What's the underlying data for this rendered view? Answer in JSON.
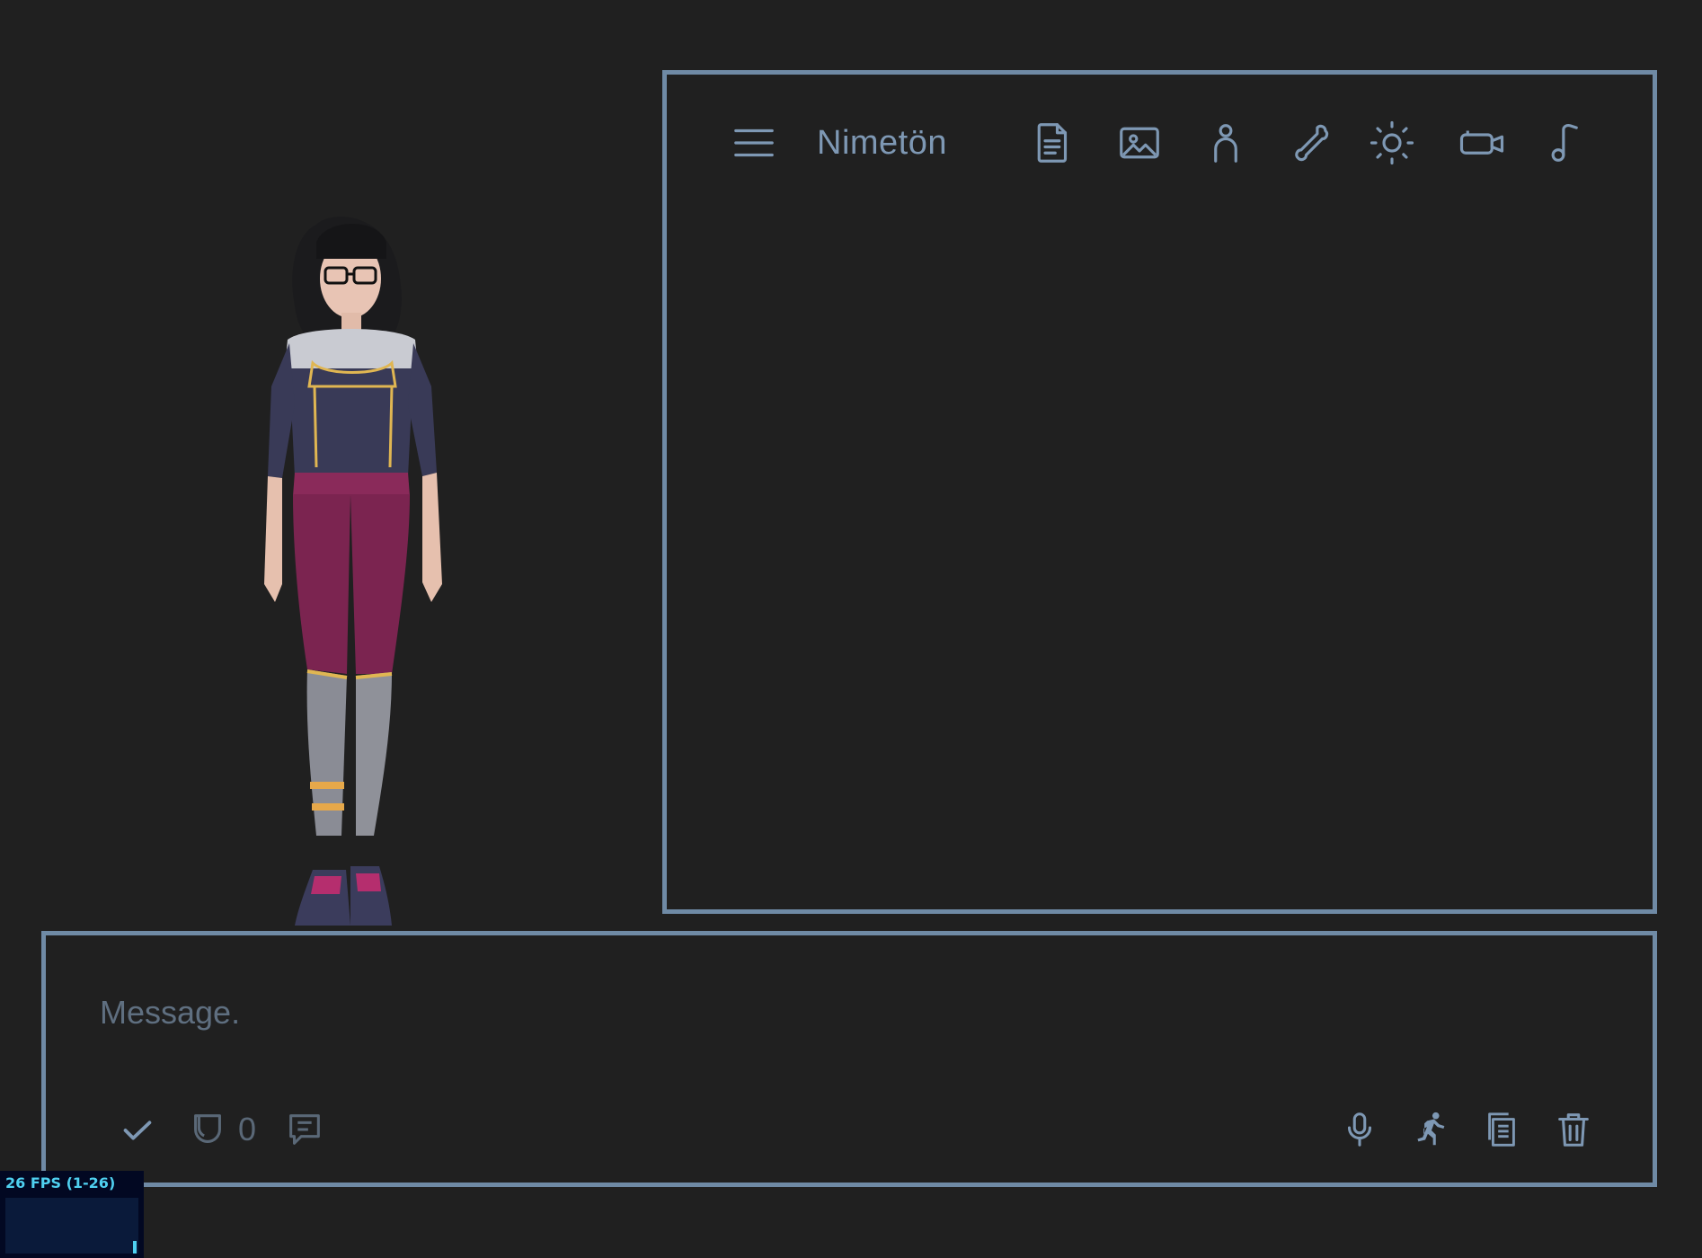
{
  "panel": {
    "title": "Nimetön",
    "toolbar_icons": [
      "menu-icon",
      "document-icon",
      "image-icon",
      "person-icon",
      "bone-icon",
      "sun-icon",
      "camera-icon",
      "music-icon"
    ]
  },
  "message_bar": {
    "placeholder": "Message.",
    "value": "",
    "token_count": "0",
    "left_icons": [
      "check-icon",
      "pocket-icon",
      "chat-icon"
    ],
    "right_icons": [
      "microphone-icon",
      "running-icon",
      "copy-document-icon",
      "trash-icon"
    ]
  },
  "fps_meter": {
    "label": "26 FPS (1-26)",
    "fps": 26
  },
  "colors": {
    "background": "#202020",
    "border": "#6f8aa5",
    "icon": "#7e98b4",
    "muted_icon": "#5a6877",
    "fps_text": "#4fd0f0"
  }
}
